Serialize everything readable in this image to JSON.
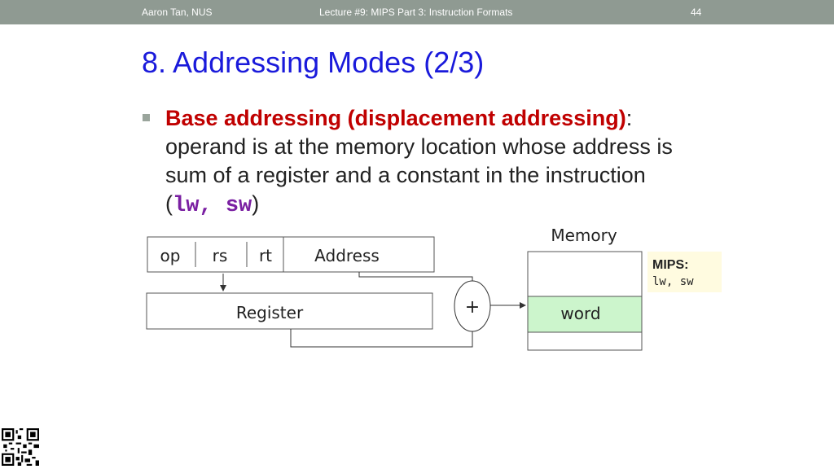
{
  "header": {
    "author": "Aaron Tan, NUS",
    "lecture": "Lecture #9: MIPS Part 3: Instruction Formats",
    "page": "44"
  },
  "title": "8. Addressing Modes (2/3)",
  "bullet": {
    "term": "Base addressing (displacement addressing)",
    "colon": ":",
    "text_before_code": "operand is at the memory location whose address is sum of a register and a constant in the instruction (",
    "code1": "lw",
    "code_sep": ", ",
    "code2": "sw",
    "text_after_code": ")"
  },
  "diagram": {
    "fields": [
      "op",
      "rs",
      "rt",
      "Address"
    ],
    "register_label": "Register",
    "adder_label": "+",
    "memory_label": "Memory",
    "word_label": "word",
    "word_color": "#ccf5cc",
    "note_title": "MIPS:",
    "note_body": "lw, sw",
    "note_color": "#fffbe0"
  },
  "colors": {
    "header_bg": "#8f9a92",
    "title": "#1a1adb",
    "term": "#c00000",
    "code": "#7a1fa2"
  }
}
